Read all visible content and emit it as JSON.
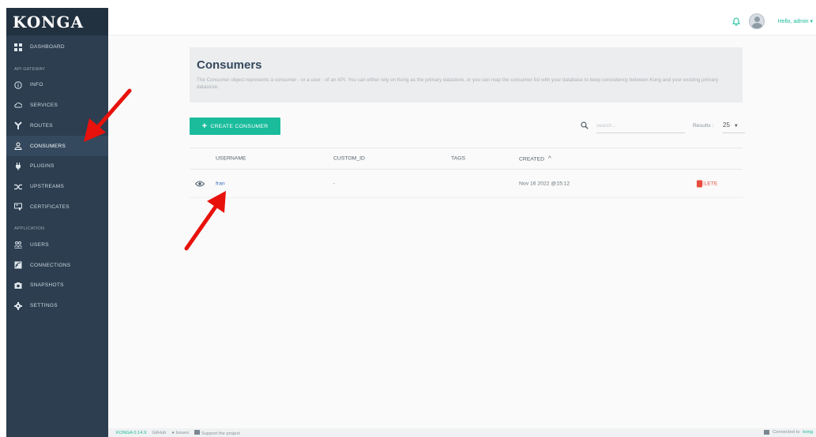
{
  "app": {
    "logo": "KONGA"
  },
  "sidebar": {
    "items_top": [
      {
        "label": "DASHBOARD",
        "icon": "dashboard-icon"
      }
    ],
    "section_api": "API GATEWAY",
    "items_api": [
      {
        "label": "INFO",
        "icon": "info-icon"
      },
      {
        "label": "SERVICES",
        "icon": "cloud-icon"
      },
      {
        "label": "ROUTES",
        "icon": "routes-icon"
      },
      {
        "label": "CONSUMERS",
        "icon": "user-icon",
        "active": true
      },
      {
        "label": "PLUGINS",
        "icon": "plug-icon"
      },
      {
        "label": "UPSTREAMS",
        "icon": "shuffle-icon"
      },
      {
        "label": "CERTIFICATES",
        "icon": "certificate-icon"
      }
    ],
    "section_app": "APPLICATION",
    "items_app": [
      {
        "label": "USERS",
        "icon": "users-icon"
      },
      {
        "label": "CONNECTIONS",
        "icon": "connections-icon"
      },
      {
        "label": "SNAPSHOTS",
        "icon": "camera-icon"
      },
      {
        "label": "SETTINGS",
        "icon": "gear-icon"
      }
    ]
  },
  "topbar": {
    "greeting": "Hello, admin ▾"
  },
  "page": {
    "title": "Consumers",
    "description": "The Consumer object represents a consumer - or a user - of an API. You can either rely on Kong as the primary datastore, or you can map the consumer list with your database to keep consistency between Kong and your existing primary datastore."
  },
  "toolbar": {
    "create_label": "CREATE CONSUMER",
    "search_placeholder": "search...",
    "results_label": "Results :",
    "results_value": "25"
  },
  "table": {
    "headers": {
      "username": "USERNAME",
      "custom_id": "CUSTOM_ID",
      "tags": "TAGS",
      "created": "CREATED"
    },
    "rows": [
      {
        "username": "fran",
        "custom_id": "-",
        "tags": "",
        "created": "Nov 16 2022 @15:12",
        "action": "DELETE"
      }
    ]
  },
  "footer": {
    "version": "KONGA 0.14.9",
    "github": "GitHub",
    "issues": "Issues",
    "support": "Support the project",
    "connected": "Connected to",
    "connected_target": "kong"
  },
  "colors": {
    "sidebar_bg": "#2c3e50",
    "accent": "#1abc9c",
    "danger": "#e74c3c",
    "link": "#3c6fc2",
    "annotation_arrow": "#e8120c"
  }
}
